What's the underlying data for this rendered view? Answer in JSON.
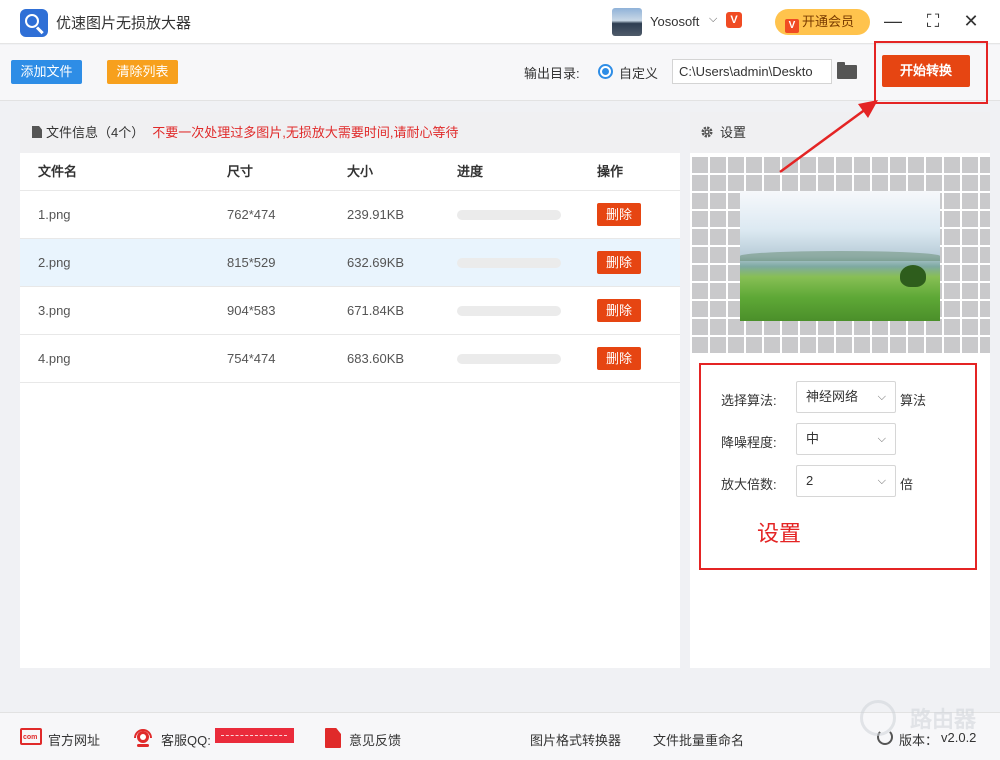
{
  "app": {
    "title": "优速图片无损放大器"
  },
  "account": {
    "name": "Yososoft",
    "vip_badge": "V",
    "vip_button": "开通会员"
  },
  "window_controls": {
    "minimize": "—",
    "maximize": "⛶",
    "close": "✕"
  },
  "toolbar": {
    "add_files": "添加文件",
    "clear_list": "清除列表",
    "output_dir_label": "输出目录:",
    "custom_option": "自定义",
    "output_path": "C:\\Users\\admin\\Deskto",
    "start_button": "开始转换"
  },
  "file_panel": {
    "title": "文件信息（4个）",
    "warning": "不要一次处理过多图片,无损放大需要时间,请耐心等待",
    "columns": [
      "文件名",
      "尺寸",
      "大小",
      "进度",
      "操作"
    ],
    "rows": [
      {
        "name": "1.png",
        "size": "762*474",
        "filesize": "239.91KB",
        "progress": 0,
        "action": "删除"
      },
      {
        "name": "2.png",
        "size": "815*529",
        "filesize": "632.69KB",
        "progress": 0,
        "action": "删除"
      },
      {
        "name": "3.png",
        "size": "904*583",
        "filesize": "671.84KB",
        "progress": 0,
        "action": "删除"
      },
      {
        "name": "4.png",
        "size": "754*474",
        "filesize": "683.60KB",
        "progress": 0,
        "action": "删除"
      }
    ],
    "selected_row_index": 1
  },
  "settings": {
    "title": "设置",
    "algorithm_label": "选择算法:",
    "algorithm_value": "神经网络",
    "algorithm_suffix": "算法",
    "denoise_label": "降噪程度:",
    "denoise_value": "中",
    "scale_label": "放大倍数:",
    "scale_value": "2",
    "scale_suffix": "倍",
    "annotation": "设置"
  },
  "footer": {
    "website": "官方网址",
    "qq_label": "客服QQ:",
    "feedback": "意见反馈",
    "format_converter": "图片格式转换器",
    "batch_rename": "文件批量重命名",
    "version_label": "版本：",
    "version": "v2.0.2",
    "watermark": "路由器"
  },
  "colors": {
    "primary": "#2e8de6",
    "danger": "#e64512",
    "warning": "#f7a01d",
    "annotation_red": "#e42424"
  }
}
